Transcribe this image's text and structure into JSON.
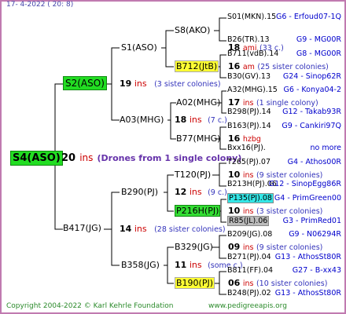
{
  "header": "17-  4-2022 ( 20:  8)",
  "root": {
    "name": "S4(ASO)",
    "num": "20",
    "ins": "ins",
    "note": "(Drones from 1 single colony)"
  },
  "g1": [
    {
      "name": "S2(ASO)",
      "num": "19",
      "ins": "ins",
      "note": "(3 sister colonies)"
    },
    {
      "name": "B417(JG)",
      "num": "14",
      "ins": "ins",
      "note": "(28 sister colonies)"
    }
  ],
  "g2": [
    {
      "name": "S1(ASO)",
      "num": "",
      "ins": "",
      "note": ""
    },
    {
      "name": "A03(MHG)",
      "num": "18",
      "ins": "ins",
      "note": "(7 c.)"
    },
    {
      "name": "B290(PJ)",
      "num": "12",
      "ins": "ins",
      "note": "(9 c.)"
    },
    {
      "name": "B358(JG)",
      "num": "11",
      "ins": "ins",
      "note": "(some c.)"
    }
  ],
  "g3": [
    {
      "name": "S8(AKO)",
      "num": "18",
      "ins": "ami",
      "note": "(33 c.)"
    },
    {
      "name": "B712(JtB)",
      "num": "16",
      "ins": "am",
      "note": "(25 sister colonies)"
    },
    {
      "name": "A02(MHG)",
      "num": "17",
      "ins": "ins",
      "note": "(1 single colony)"
    },
    {
      "name": "B77(MHG)",
      "num": "16",
      "ins": "hzbg",
      "note": ""
    },
    {
      "name": "T120(PJ)",
      "num": "10",
      "ins": "ins",
      "note": "(9 sister colonies)"
    },
    {
      "name": "P216H(PJ)",
      "num": "10",
      "ins": "ins",
      "note": "(3 sister colonies)"
    },
    {
      "name": "B329(JG)",
      "num": "09",
      "ins": "ins",
      "note": "(9 sister colonies)"
    },
    {
      "name": "B190(PJ)",
      "num": "06",
      "ins": "ins",
      "note": "(10 sister colonies)"
    }
  ],
  "g4": [
    {
      "name": "S01(MKN).15",
      "id": "G6 - Erfoud07-1Q"
    },
    {
      "name": "B26(TR).13",
      "id": "G9 - MG00R"
    },
    {
      "name": "B711(vdB).14",
      "id": "G8 - MG00R"
    },
    {
      "name": "B30(GV).13",
      "id": "G24 - Sinop62R"
    },
    {
      "name": "A32(MHG).15",
      "id": "G6 - Konya04-2"
    },
    {
      "name": "B298(PJ).14",
      "id": "G12 - Takab93R"
    },
    {
      "name": "B163(PJ).14",
      "id": "G9 - Cankiri97Q"
    },
    {
      "name": "Bxx16(PJ).",
      "id": "no more"
    },
    {
      "name": "T265(PJ).07",
      "id": "G4 - Athos00R"
    },
    {
      "name": "B213H(PJ).06",
      "id": "G12 - SinopEgg86R"
    },
    {
      "name": "P135(PJ).08",
      "id": "G4 - PrimGreen00"
    },
    {
      "name": "R85(JL).06",
      "id": "G3 - PrimRed01"
    },
    {
      "name": "B209(JG).08",
      "id": "G9 - N06294R"
    },
    {
      "name": "B271(PJ).04",
      "id": "G13 - AthosSt80R"
    },
    {
      "name": "B811(FF).04",
      "id": "G27 - B-xx43"
    },
    {
      "name": "B248(PJ).02",
      "id": "G13 - AthosSt80R"
    }
  ],
  "footer": {
    "copyright": "Copyright 2004-2022 © Karl Kehrle Foundation",
    "url": "www.pedigreeapis.org"
  }
}
